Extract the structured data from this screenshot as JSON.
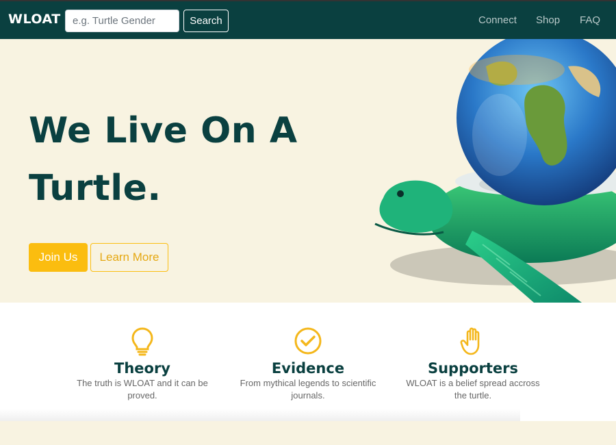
{
  "header": {
    "logo": "WLOAT",
    "search": {
      "placeholder": "e.g. Turtle Gender",
      "value": ""
    },
    "search_label": "Search",
    "nav": [
      "Connect",
      "Shop",
      "FAQ"
    ]
  },
  "hero": {
    "title_line1": "We Live On A",
    "title_line2": "Turtle.",
    "join_label": "Join Us",
    "learn_label": "Learn More"
  },
  "features": [
    {
      "icon": "lightbulb-icon",
      "title": "Theory",
      "text": "The truth is WLOAT and it can be proved."
    },
    {
      "icon": "check-circle-icon",
      "title": "Evidence",
      "text": "From mythical legends to scientific journals."
    },
    {
      "icon": "hand-icon",
      "title": "Supporters",
      "text": "WLOAT is a belief spread accross the turtle."
    }
  ],
  "colors": {
    "brand": "#0a4040",
    "accent": "#fbbd0f",
    "cream": "#f8f3e1"
  }
}
